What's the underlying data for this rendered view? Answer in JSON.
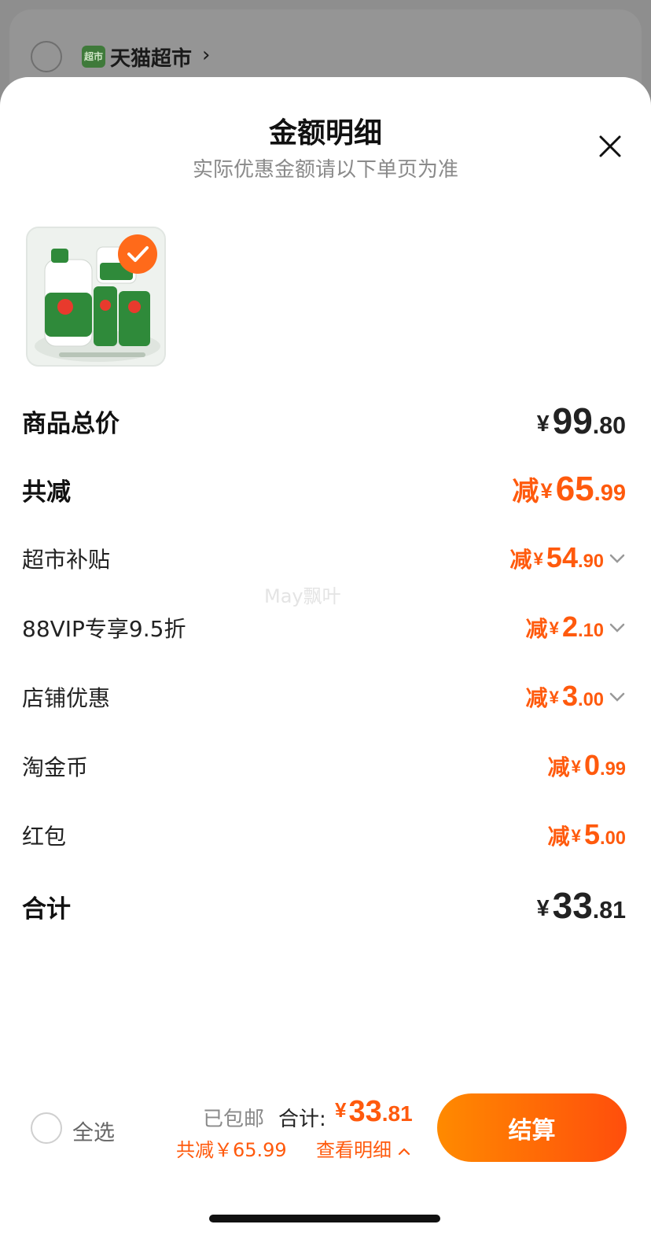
{
  "background": {
    "store_name": "天猫超市",
    "store_icon_text": "超市"
  },
  "sheet": {
    "title": "金额明细",
    "subtitle": "实际优惠金额请以下单页为准"
  },
  "rows": {
    "subtotal": {
      "label": "商品总价",
      "currency": "¥",
      "int": "99",
      "dec": ".80"
    },
    "total_discount": {
      "label": "共减",
      "prefix": "减",
      "currency": "¥",
      "int": "65",
      "dec": ".99"
    },
    "supermarket_subsidy": {
      "label": "超市补贴",
      "prefix": "减",
      "currency": "¥",
      "int": "54",
      "dec": ".90"
    },
    "vip": {
      "label": "88VIP专享9.5折",
      "prefix": "减",
      "currency": "¥",
      "int": "2",
      "dec": ".10"
    },
    "store_discount": {
      "label": "店铺优惠",
      "prefix": "减",
      "currency": "¥",
      "int": "3",
      "dec": ".00"
    },
    "taojinbi": {
      "label": "淘金币",
      "prefix": "减",
      "currency": "¥",
      "int": "0",
      "dec": ".99"
    },
    "red_packet": {
      "label": "红包",
      "prefix": "减",
      "currency": "¥",
      "int": "5",
      "dec": ".00"
    },
    "total": {
      "label": "合计",
      "currency": "¥",
      "int": "33",
      "dec": ".81"
    }
  },
  "watermark": "May飘叶",
  "bottom_bar": {
    "select_all": "全选",
    "free_shipping": "已包邮",
    "total_label": "合计:",
    "total_currency": "¥",
    "total_int": "33",
    "total_dec": ".81",
    "saved_text": "共减￥65.99",
    "detail_link": "查看明细",
    "checkout": "结算"
  },
  "colors": {
    "accent": "#ff5a0d",
    "button_start": "#ff8a00",
    "button_end": "#ff4e0c",
    "product_green": "#2f8a3a"
  }
}
